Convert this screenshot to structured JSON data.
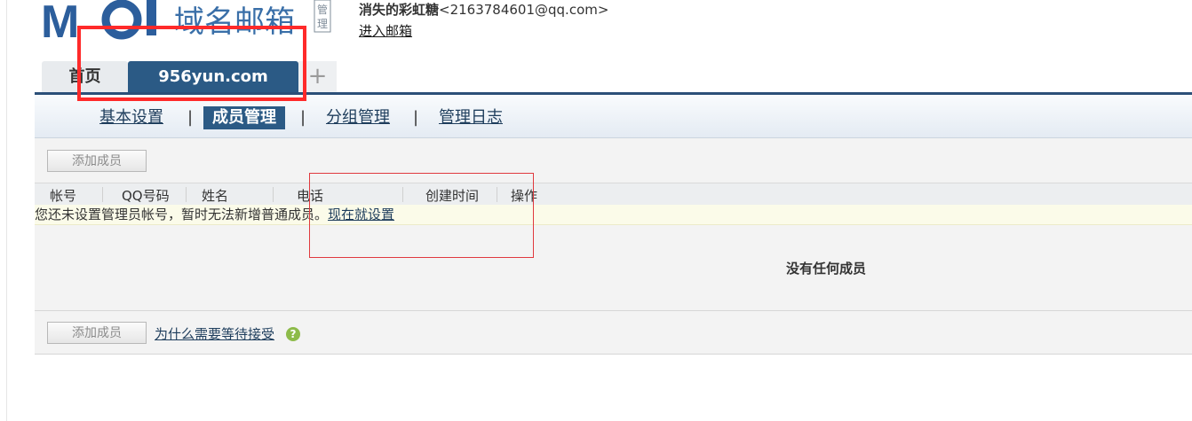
{
  "logo": {
    "text": "域名邮箱",
    "seal": "管理",
    "icon": "moi-logo-icon"
  },
  "user": {
    "name": "消失的彩虹糖",
    "email": "<2163784601@qq.com>",
    "enter_mailbox": "进入邮箱"
  },
  "tabs": {
    "home": "首页",
    "domain": "956yun.com",
    "add": "+"
  },
  "subnav": {
    "items": [
      "基本设置",
      "成员管理",
      "分组管理",
      "管理日志"
    ],
    "active": "成员管理",
    "separator": "|"
  },
  "toolbar": {
    "add_member": "添加成员"
  },
  "table": {
    "columns": [
      "帐号",
      "QQ号码",
      "姓名",
      "电话",
      "创建时间",
      "操作"
    ]
  },
  "notice": {
    "text": "您还未设置管理员帐号，暂时无法新增普通成员。",
    "link": "现在就设置"
  },
  "empty_state": "没有任何成员",
  "footer": {
    "add_member": "添加成员",
    "why_link": "为什么需要等待接受",
    "help_icon": "?"
  },
  "colors": {
    "accent": "#2b5a85",
    "highlight": "#ff2a2a",
    "help_icon": "#8dbb4a",
    "notice_bg": "#fbfbe9"
  }
}
